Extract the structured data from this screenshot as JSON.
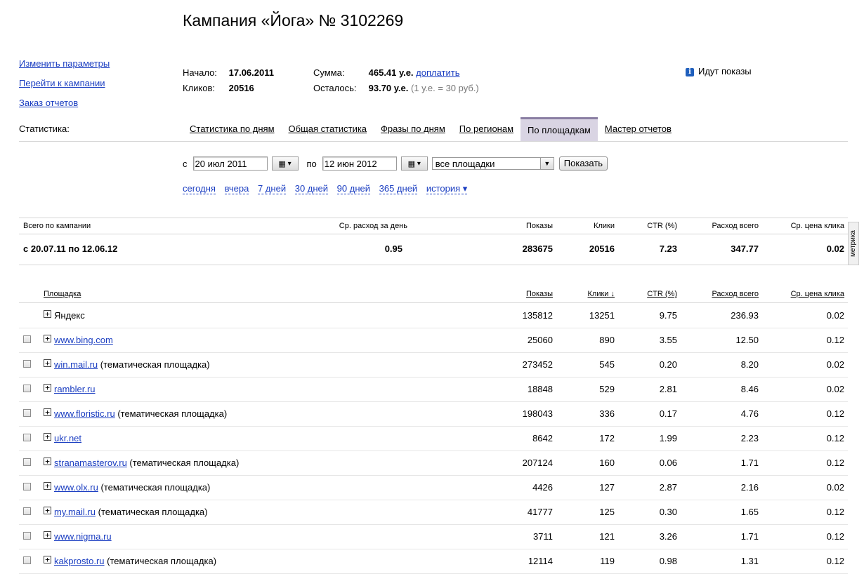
{
  "title": "Кампания «Йога» № 3102269",
  "sidebar": [
    {
      "label": "Изменить параметры"
    },
    {
      "label": "Перейти к кампании"
    },
    {
      "label": "Заказ отчетов"
    }
  ],
  "meta": {
    "start_label": "Начало:",
    "start_value": "17.06.2011",
    "clicks_label": "Кликов:",
    "clicks_value": "20516",
    "sum_label": "Сумма:",
    "sum_value": "465.41 у.е.",
    "topup_label": "доплатить",
    "remain_label": "Осталось:",
    "remain_value": "93.70 у.е.",
    "rate_hint": "(1 у.е. = 30 руб.)"
  },
  "status": {
    "icon": "info-icon",
    "text": "Идут показы"
  },
  "stats_label": "Статистика:",
  "tabs": [
    {
      "label": "Статистика по дням",
      "active": false
    },
    {
      "label": "Общая статистика",
      "active": false
    },
    {
      "label": "Фразы по дням",
      "active": false
    },
    {
      "label": "По регионам",
      "active": false
    },
    {
      "label": "По площадкам",
      "active": true
    },
    {
      "label": "Мастер отчетов",
      "active": false
    }
  ],
  "filters": {
    "from_label": "с",
    "from_value": "20 июл 2011",
    "to_label": "по",
    "to_value": "12 июн 2012",
    "select_value": "все площадки",
    "show_button": "Показать"
  },
  "quick_periods": [
    "сегодня",
    "вчера",
    "7 дней",
    "30 дней",
    "90 дней",
    "365 дней",
    "история ▾"
  ],
  "summary": {
    "headers": {
      "label": "Всего по кампании",
      "avg": "Ср. расход за день",
      "shows": "Показы",
      "clicks": "Клики",
      "ctr": "CTR (%)",
      "spend": "Расход всего",
      "cpc": "Ср. цена клика"
    },
    "row": {
      "label": "с 20.07.11 по 12.06.12",
      "avg": "0.95",
      "shows": "283675",
      "clicks": "20516",
      "ctr": "7.23",
      "spend": "347.77",
      "cpc": "0.02"
    },
    "metrika_tab": "метрика"
  },
  "table": {
    "headers": {
      "site": "Площадка",
      "shows": "Показы",
      "clicks": "Клики ↓",
      "ctr": "CTR (%)",
      "spend": "Расход всего",
      "cpc": "Ср. цена клика"
    },
    "rows": [
      {
        "site": "Яндекс",
        "link": false,
        "suffix": "",
        "checkbox": false,
        "shows": "135812",
        "clicks": "13251",
        "ctr": "9.75",
        "spend": "236.93",
        "cpc": "0.02"
      },
      {
        "site": "www.bing.com",
        "link": true,
        "suffix": "",
        "checkbox": true,
        "shows": "25060",
        "clicks": "890",
        "ctr": "3.55",
        "spend": "12.50",
        "cpc": "0.12"
      },
      {
        "site": "win.mail.ru",
        "link": true,
        "suffix": "(тематическая площадка)",
        "checkbox": true,
        "shows": "273452",
        "clicks": "545",
        "ctr": "0.20",
        "spend": "8.20",
        "cpc": "0.02"
      },
      {
        "site": "rambler.ru",
        "link": true,
        "suffix": "",
        "checkbox": true,
        "shows": "18848",
        "clicks": "529",
        "ctr": "2.81",
        "spend": "8.46",
        "cpc": "0.02"
      },
      {
        "site": "www.floristic.ru",
        "link": true,
        "suffix": "(тематическая площадка)",
        "checkbox": true,
        "shows": "198043",
        "clicks": "336",
        "ctr": "0.17",
        "spend": "4.76",
        "cpc": "0.12"
      },
      {
        "site": "ukr.net",
        "link": true,
        "suffix": "",
        "checkbox": true,
        "shows": "8642",
        "clicks": "172",
        "ctr": "1.99",
        "spend": "2.23",
        "cpc": "0.12"
      },
      {
        "site": "stranamasterov.ru",
        "link": true,
        "suffix": "(тематическая площадка)",
        "checkbox": true,
        "shows": "207124",
        "clicks": "160",
        "ctr": "0.06",
        "spend": "1.71",
        "cpc": "0.12"
      },
      {
        "site": "www.olx.ru",
        "link": true,
        "suffix": "(тематическая площадка)",
        "checkbox": true,
        "shows": "4426",
        "clicks": "127",
        "ctr": "2.87",
        "spend": "2.16",
        "cpc": "0.02"
      },
      {
        "site": "my.mail.ru",
        "link": true,
        "suffix": "(тематическая площадка)",
        "checkbox": true,
        "shows": "41777",
        "clicks": "125",
        "ctr": "0.30",
        "spend": "1.65",
        "cpc": "0.12"
      },
      {
        "site": "www.nigma.ru",
        "link": true,
        "suffix": "",
        "checkbox": true,
        "shows": "3711",
        "clicks": "121",
        "ctr": "3.26",
        "spend": "1.71",
        "cpc": "0.12"
      },
      {
        "site": "kakprosto.ru",
        "link": true,
        "suffix": "(тематическая площадка)",
        "checkbox": true,
        "shows": "12114",
        "clicks": "119",
        "ctr": "0.98",
        "spend": "1.31",
        "cpc": "0.12"
      }
    ]
  }
}
